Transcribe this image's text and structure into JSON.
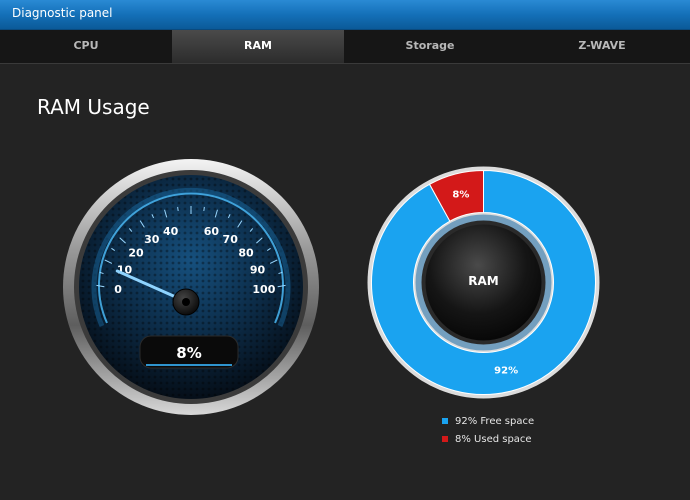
{
  "window": {
    "title": "Diagnostic panel"
  },
  "tabs": [
    {
      "label": "CPU",
      "active": false
    },
    {
      "label": "RAM",
      "active": true
    },
    {
      "label": "Storage",
      "active": false
    },
    {
      "label": "Z-WAVE",
      "active": false
    }
  ],
  "page": {
    "heading": "RAM Usage"
  },
  "gauge": {
    "value": 8,
    "readout": "8%",
    "min": 0,
    "max": 100,
    "tick_labels": [
      "0",
      "10",
      "20",
      "30",
      "40",
      "60",
      "70",
      "80",
      "90",
      "100"
    ]
  },
  "chart_data": {
    "type": "pie",
    "center_label": "RAM",
    "slices": [
      {
        "label": "92% Free space",
        "value": 92,
        "data_label": "92%",
        "color": "#1aa3f0"
      },
      {
        "label": "8% Used space",
        "value": 8,
        "data_label": "8%",
        "color": "#d31919"
      }
    ]
  },
  "colors": {
    "accent": "#1aa3f0",
    "used": "#d31919",
    "titlebar": "#1470b8",
    "background": "#232323"
  }
}
